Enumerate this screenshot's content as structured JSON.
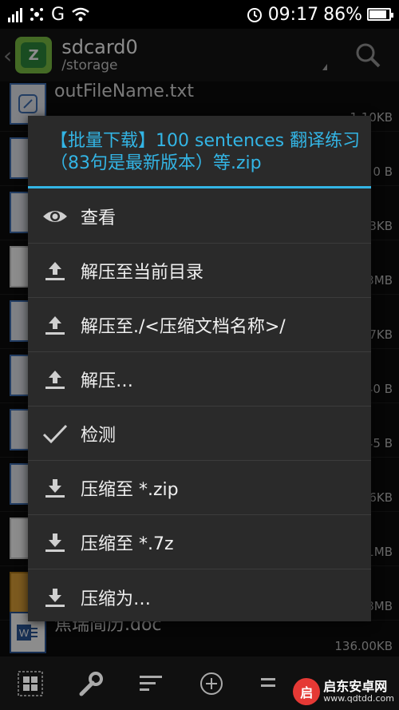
{
  "status": {
    "carrier_g": "G",
    "time": "09:17",
    "battery": "86%",
    "battery_level": 0.86
  },
  "appbar": {
    "title": "sdcard0",
    "path": "/storage"
  },
  "files": [
    {
      "name": "outFileName.txt",
      "size": "1.10KB"
    },
    {
      "name": "",
      "size": "0 B"
    },
    {
      "name": "",
      "size": "3KB"
    },
    {
      "name": "",
      "size": "3MB"
    },
    {
      "name": "",
      "size": "7KB"
    },
    {
      "name": "",
      "size": "40 B"
    },
    {
      "name": "",
      "size": "45 B"
    },
    {
      "name": "",
      "size": "6KB"
    },
    {
      "name": "",
      "size": "1MB"
    },
    {
      "name": "",
      "size": "8MB"
    },
    {
      "name": "焦瑞简历.doc",
      "size": "136.00KB"
    }
  ],
  "dialog": {
    "title": "【批量下载】100 sentences 翻译练习（83句是最新版本）等.zip",
    "items": [
      {
        "label": "查看",
        "icon": "eye-icon"
      },
      {
        "label": "解压至当前目录",
        "icon": "upload-icon"
      },
      {
        "label": "解压至./<压缩文档名称>/",
        "icon": "upload-icon"
      },
      {
        "label": "解压…",
        "icon": "upload-icon"
      },
      {
        "label": "检测",
        "icon": "checkmark-icon"
      },
      {
        "label": "压缩至 *.zip",
        "icon": "download-icon"
      },
      {
        "label": "压缩至 *.7z",
        "icon": "download-icon"
      },
      {
        "label": "压缩为…",
        "icon": "download-icon"
      }
    ]
  },
  "watermark": {
    "name": "启东安卓网",
    "url": "www.qdtdd.com"
  },
  "colors": {
    "accent": "#33b5e5",
    "dialog_bg": "#2a2a2a"
  }
}
